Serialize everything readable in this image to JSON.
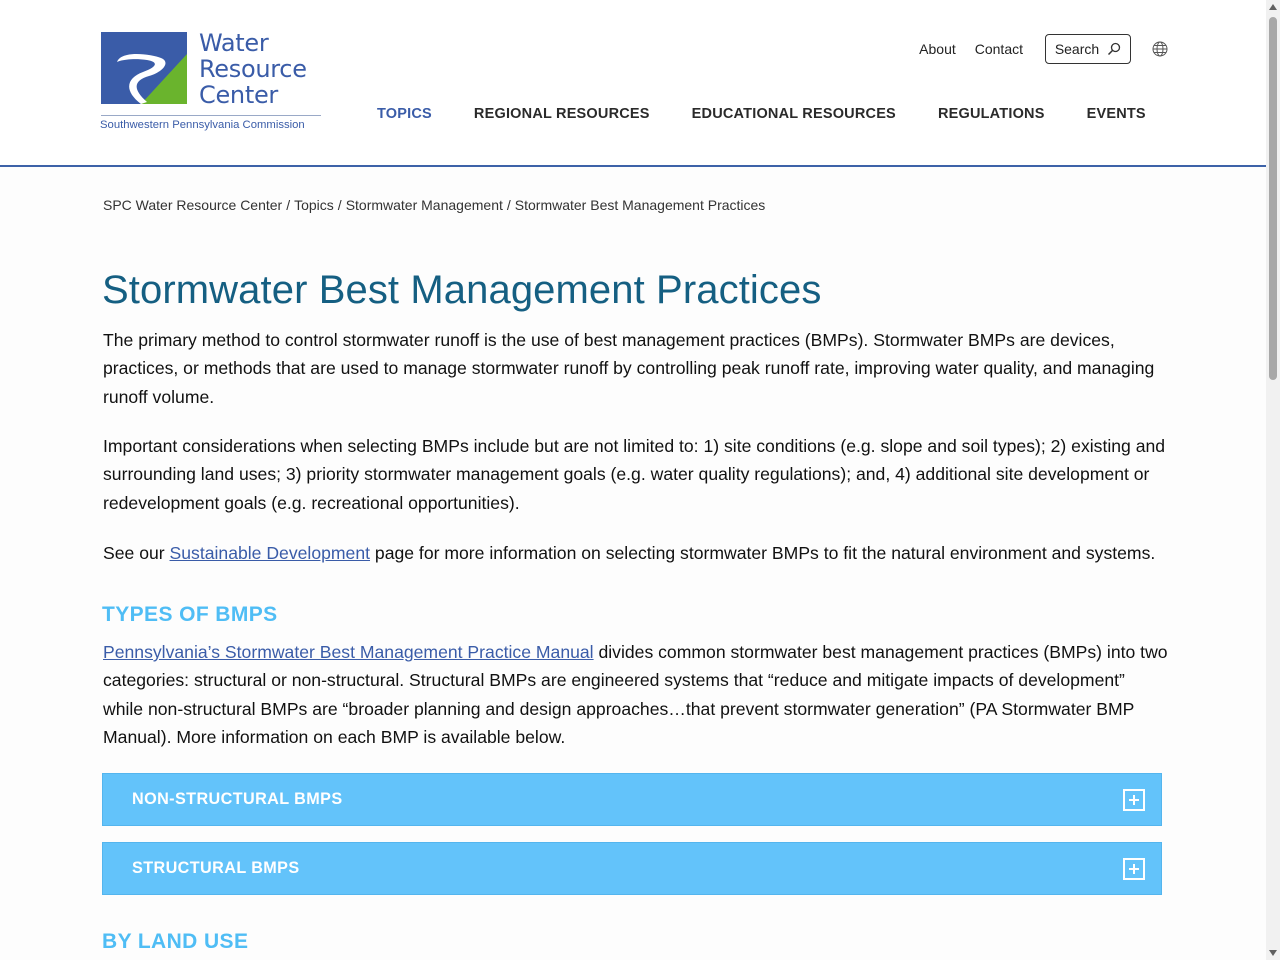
{
  "header": {
    "logo": {
      "line1": "Water",
      "line2": "Resource",
      "line3": "Center",
      "subtitle": "Southwestern Pennsylvania Commission"
    },
    "utility": {
      "about": "About",
      "contact": "Contact",
      "search": "Search"
    },
    "nav": [
      {
        "label": "TOPICS",
        "active": true
      },
      {
        "label": "REGIONAL RESOURCES"
      },
      {
        "label": "EDUCATIONAL RESOURCES"
      },
      {
        "label": "REGULATIONS"
      },
      {
        "label": "EVENTS"
      }
    ]
  },
  "breadcrumb": [
    "SPC Water Resource Center",
    "Topics",
    "Stormwater Management",
    "Stormwater Best Management Practices"
  ],
  "breadcrumb_separator": "/",
  "page": {
    "title": "Stormwater Best Management Practices",
    "intro": "The primary method to control stormwater runoff is the use of best management practices (BMPs). Stormwater BMPs are devices, practices, or methods that are used to manage stormwater runoff by controlling peak runoff rate, improving water quality, and managing runoff volume.",
    "considerations": "Important considerations when selecting BMPs include but are not limited to: 1) site conditions (e.g. slope and soil types); 2) existing and surrounding land uses; 3) priority stormwater management goals (e.g. water quality regulations); and, 4) additional site development or redevelopment goals (e.g. recreational opportunities).",
    "see_our_before": "See our ",
    "see_our_link": "Sustainable Development",
    "see_our_after": " page for more information on selecting stormwater BMPs to fit the natural environment and systems.",
    "types_heading": "TYPES OF BMPS",
    "types_link": "Pennsylvania’s Stormwater Best Management Practice Manual",
    "types_text": " divides common stormwater best management practices (BMPs) into two categories: structural or non-structural. Structural BMPs are engineered systems that “reduce and mitigate impacts of development” while non-structural BMPs are “broader planning and design approaches…that prevent stormwater generation” (PA Stormwater BMP Manual). More information on each BMP is available below.",
    "accordions": [
      {
        "label": "NON-STRUCTURAL BMPS",
        "expanded": false
      },
      {
        "label": "STRUCTURAL BMPS",
        "expanded": false
      }
    ],
    "land_use_heading": "BY LAND USE"
  },
  "colors": {
    "brand_blue": "#3a5ca8",
    "brand_green": "#6ab42d",
    "title_teal": "#155f82",
    "accent_light_blue": "#4fbdf5",
    "accordion_bg": "#63c3fa"
  },
  "icons": [
    "search-icon",
    "globe-icon",
    "plus-icon"
  ]
}
